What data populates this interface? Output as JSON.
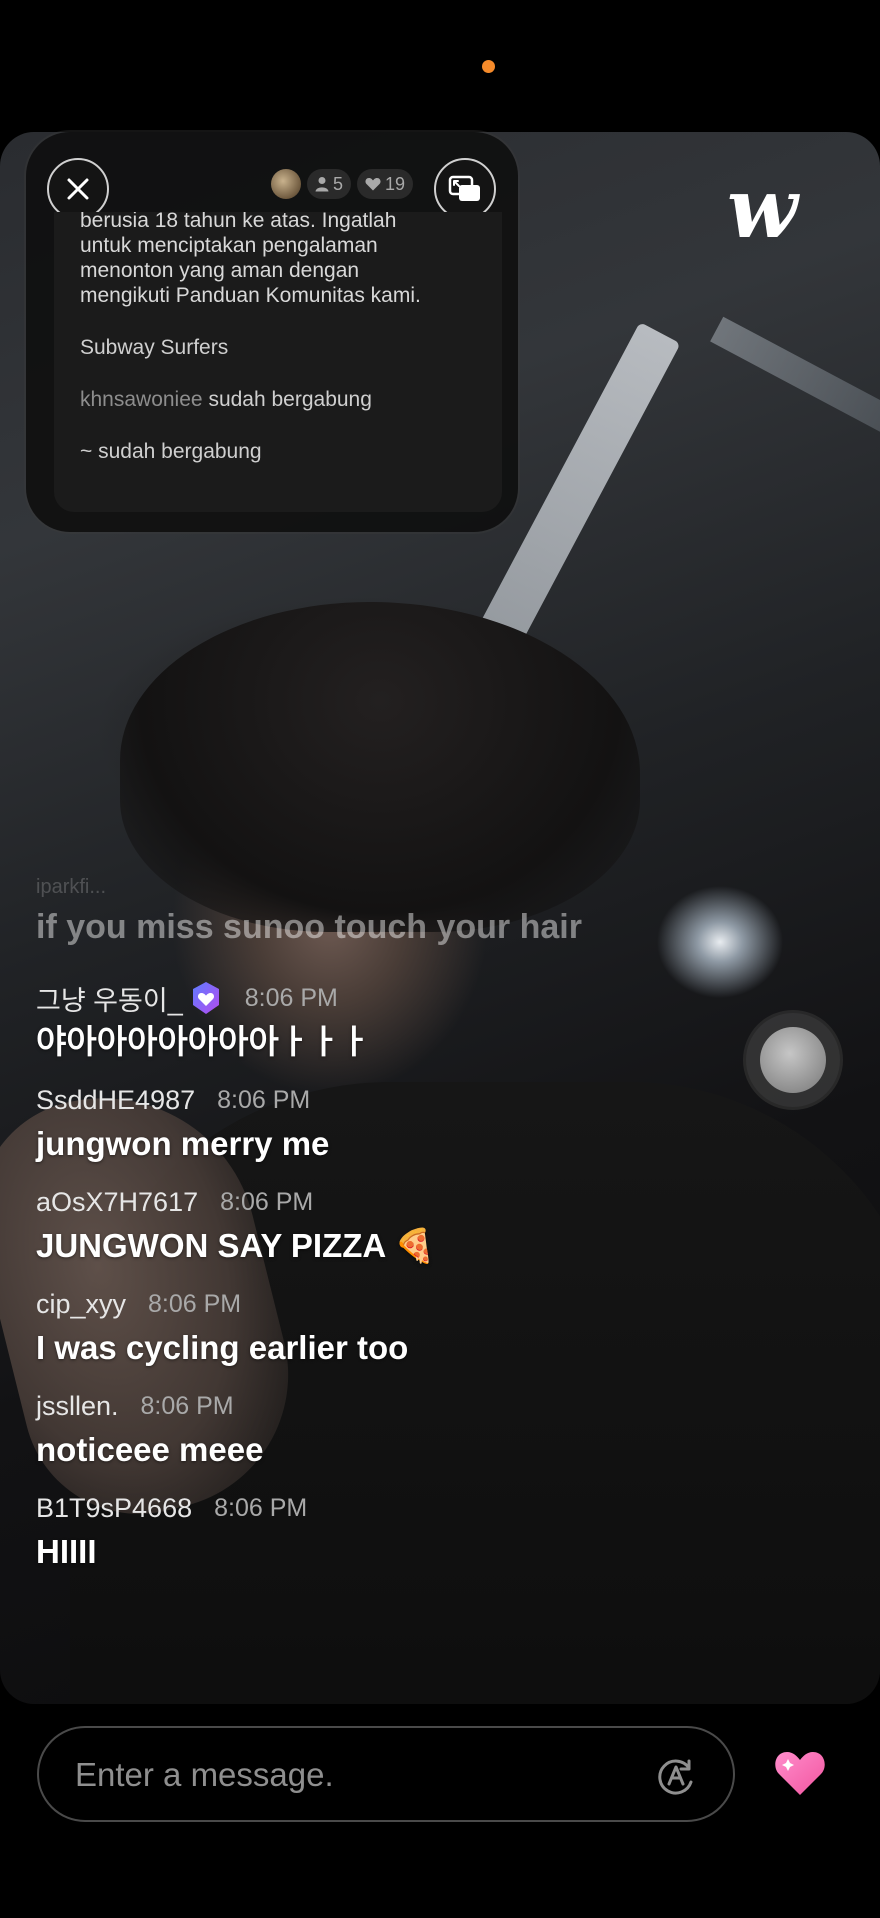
{
  "status_bar": {
    "indicator_color": "#f58a2a"
  },
  "logo": {
    "text": "w"
  },
  "top_panel": {
    "viewer_count": "5",
    "like_count": "19",
    "notice_lines": [
      "berusia 18 tahun ke atas. Ingatlah",
      "untuk menciptakan pengalaman",
      "menonton yang aman dengan",
      "mengikuti Panduan Komunitas kami."
    ],
    "live_title": "Subway Surfers",
    "join_user": "khnsawoniee",
    "join_text": "sudah bergabung",
    "join2_user": "~",
    "join2_text": "sudah bergabung"
  },
  "faded_messages": {
    "user": "iparkfi...",
    "text": "if you miss sunoo touch your hair"
  },
  "chat": [
    {
      "user": "그냥 우동이_",
      "time": "8:06 PM",
      "text": "야아아아아아아아ㅏㅏㅏ",
      "verified": true
    },
    {
      "user": "SsddHE4987",
      "time": "8:06 PM",
      "text": "jungwon merry me"
    },
    {
      "user": "aOsX7H7617",
      "time": "8:06 PM",
      "text": "JUNGWON SAY PIZZA 🍕"
    },
    {
      "user": "cip_xyy",
      "time": "8:06 PM",
      "text": "I was cycling earlier too"
    },
    {
      "user": "jssllen.",
      "time": "8:06 PM",
      "text": "noticeee meee"
    },
    {
      "user": "B1T9sP4668",
      "time": "8:06 PM",
      "text": "HIIII"
    }
  ],
  "composer": {
    "placeholder": "Enter a message.",
    "heart_color": "#f56fb7"
  },
  "icons": {
    "close": "close-icon",
    "pip": "picture-in-picture-icon",
    "viewer": "person-icon",
    "like": "heart-icon",
    "translate": "translate-icon",
    "verified": "verified-badge-icon"
  }
}
